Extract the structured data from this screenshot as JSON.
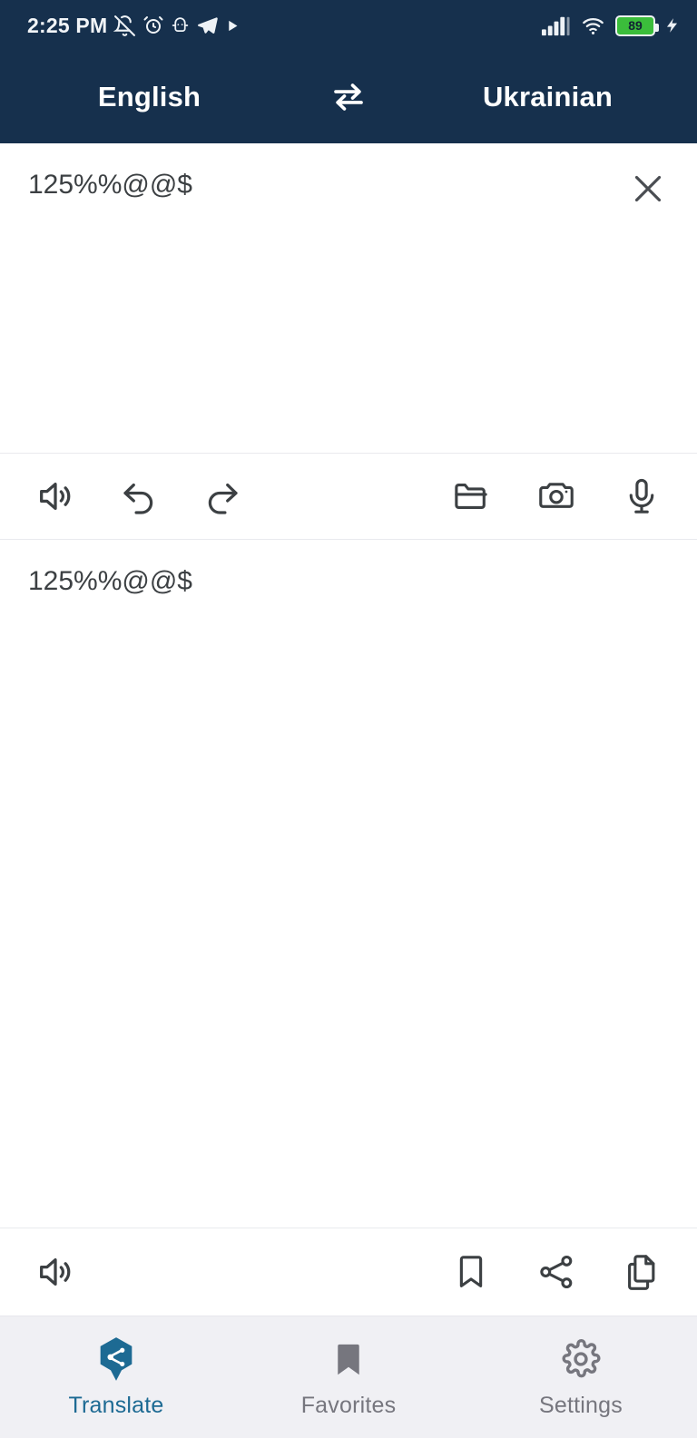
{
  "status_bar": {
    "time": "2:25 PM",
    "battery_level": "89",
    "icons": [
      "bell-off-icon",
      "alarm-icon",
      "android-debug-icon",
      "telegram-icon",
      "play-icon",
      "signal-icon",
      "wifi-icon",
      "battery-icon",
      "charging-bolt-icon"
    ]
  },
  "header": {
    "source_language": "English",
    "target_language": "Ukrainian",
    "swap_icon": "swap-horizontal-icon",
    "background_color": "#16304d"
  },
  "source_panel": {
    "text": "125%%@@$",
    "clear_icon": "close-icon"
  },
  "source_toolbar": {
    "left": [
      {
        "name": "speak-source-button",
        "icon": "speaker-icon"
      },
      {
        "name": "undo-button",
        "icon": "undo-icon"
      },
      {
        "name": "redo-button",
        "icon": "redo-icon"
      }
    ],
    "right": [
      {
        "name": "open-file-button",
        "icon": "folder-icon"
      },
      {
        "name": "camera-button",
        "icon": "camera-icon"
      },
      {
        "name": "voice-input-button",
        "icon": "microphone-icon"
      }
    ]
  },
  "result_panel": {
    "text": "125%%@@$"
  },
  "result_toolbar": {
    "left": [
      {
        "name": "speak-result-button",
        "icon": "speaker-icon"
      }
    ],
    "right": [
      {
        "name": "bookmark-button",
        "icon": "bookmark-icon"
      },
      {
        "name": "share-button",
        "icon": "share-icon"
      },
      {
        "name": "copy-button",
        "icon": "copy-icon"
      }
    ]
  },
  "bottom_nav": {
    "active_color": "#1d6a93",
    "inactive_color": "#76767e",
    "items": [
      {
        "label": "Translate",
        "icon": "translate-badge-icon",
        "active": true
      },
      {
        "label": "Favorites",
        "icon": "bookmark-filled-icon",
        "active": false
      },
      {
        "label": "Settings",
        "icon": "gear-icon",
        "active": false
      }
    ]
  }
}
